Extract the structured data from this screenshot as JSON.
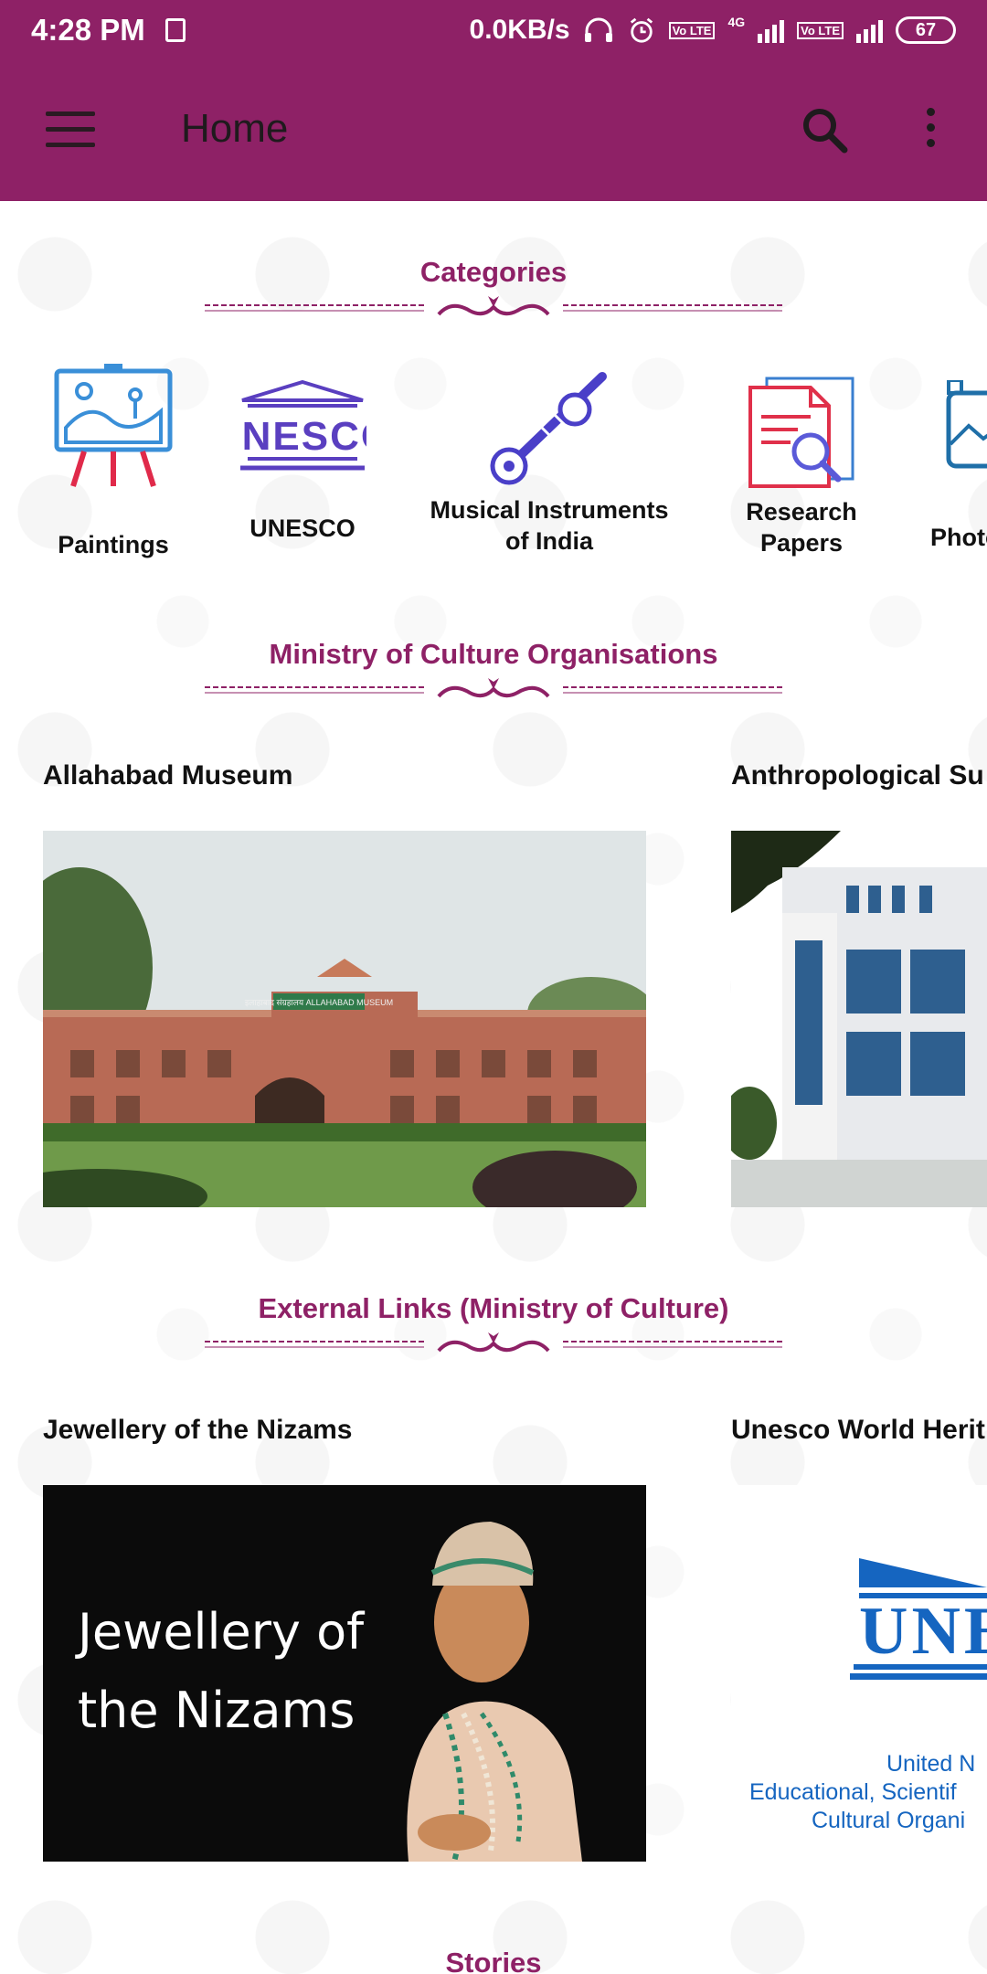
{
  "status": {
    "time": "4:28 PM",
    "speed": "0.0KB/s",
    "network": "4G",
    "volte": "Vo LTE",
    "battery": "67"
  },
  "appbar": {
    "title": "Home"
  },
  "sections": {
    "categories": "Categories",
    "organisations": "Ministry of Culture Organisations",
    "external": "External Links (Ministry of Culture)",
    "stories": "Stories"
  },
  "categories": [
    {
      "label": "Paintings",
      "icon": "easel-painting-icon"
    },
    {
      "label": "UNESCO",
      "icon": "unesco-building-icon"
    },
    {
      "label_line1": "Musical Instruments",
      "label_line2": "of India",
      "icon": "sitar-icon"
    },
    {
      "label_line1": "Research",
      "label_line2": "Papers",
      "icon": "document-search-icon"
    },
    {
      "label": "Photo",
      "icon": "photo-icon"
    }
  ],
  "organisations": [
    {
      "title": "Allahabad Museum",
      "sign": "इलाहाबाद संग्रहालय ALLAHABAD MUSEUM"
    },
    {
      "title": "Anthropological Su"
    }
  ],
  "external_links": [
    {
      "title": "Jewellery of the Nizams",
      "overlay_line1": "Jewellery of",
      "overlay_line2": "the Nizams"
    },
    {
      "title": "Unesco World Herit",
      "logo_text": "UNES",
      "org_line1": "United N",
      "org_line2": "Educational, Scientif",
      "org_line3": "Cultural Organi"
    }
  ],
  "colors": {
    "primary": "#8e2166",
    "accent": "#8e2166"
  }
}
